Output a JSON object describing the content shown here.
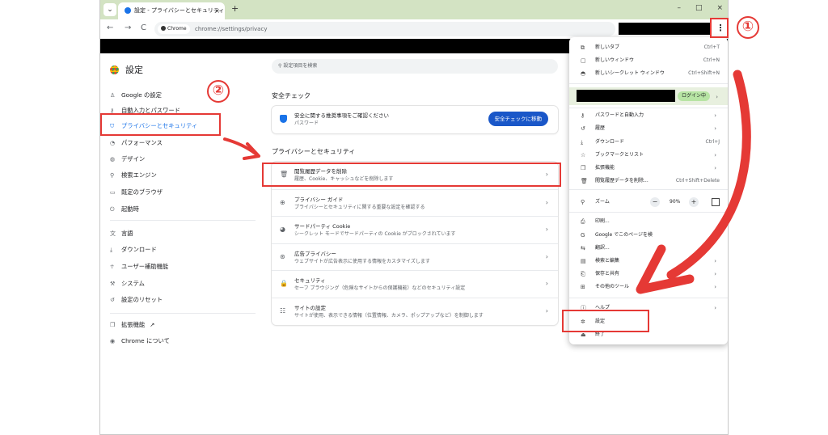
{
  "tab": {
    "title": "設定 - プライバシーとセキュリティ",
    "close": "×",
    "new": "+"
  },
  "window": {
    "minimize": "–",
    "maximize": "□",
    "close": "×",
    "dropdown": "⌄"
  },
  "toolbar": {
    "back": "←",
    "forward": "→",
    "reload": "C",
    "chip": "Chrome",
    "url": "chrome://settings/privacy",
    "menu": "⋮"
  },
  "sidebar": {
    "title": "設定",
    "items": [
      {
        "icon": "♙",
        "label": "Google の設定"
      },
      {
        "icon": "⚷",
        "label": "自動入力とパスワード"
      },
      {
        "icon": "⛉",
        "label": "プライバシーとセキュリティ"
      },
      {
        "icon": "◔",
        "label": "パフォーマンス"
      },
      {
        "icon": "◍",
        "label": "デザイン"
      },
      {
        "icon": "⚲",
        "label": "検索エンジン"
      },
      {
        "icon": "▭",
        "label": "既定のブラウザ"
      },
      {
        "icon": "⏻",
        "label": "起動時"
      },
      {
        "icon": "文",
        "label": "言語"
      },
      {
        "icon": "⤓",
        "label": "ダウンロード"
      },
      {
        "icon": "☥",
        "label": "ユーザー補助機能"
      },
      {
        "icon": "⚒",
        "label": "システム"
      },
      {
        "icon": "↺",
        "label": "設定のリセット"
      },
      {
        "icon": "❒",
        "label": "拡張機能",
        "extra": "↗"
      },
      {
        "icon": "◉",
        "label": "Chrome について"
      }
    ]
  },
  "main": {
    "search_placeholder": "設定項目を検索",
    "safety_title": "安全チェック",
    "safety": {
      "line1": "安全に関する推奨事項をご確認ください",
      "line2": "パスワード",
      "button": "安全チェックに移動"
    },
    "privacy_title": "プライバシーとセキュリティ",
    "rows": [
      {
        "icon": "🗑",
        "t1": "閲覧履歴データを削除",
        "t2": "履歴、Cookie、キャッシュなどを削除します"
      },
      {
        "icon": "⊕",
        "t1": "プライバシー ガイド",
        "t2": "プライバシーとセキュリティに関する重要な設定を確認する"
      },
      {
        "icon": "◕",
        "t1": "サードパーティ Cookie",
        "t2": "シークレット モードでサードパーティの Cookie がブロックされています"
      },
      {
        "icon": "⊛",
        "t1": "広告プライバシー",
        "t2": "ウェブサイトが広告表示に使用する情報をカスタマイズします"
      },
      {
        "icon": "🔒",
        "t1": "セキュリティ",
        "t2": "セーフ ブラウジング（危険なサイトからの保護機能）などのセキュリティ設定"
      },
      {
        "icon": "☷",
        "t1": "サイトの設定",
        "t2": "サイトが使用、表示できる情報（位置情報、カメラ、ポップアップなど）を制御します"
      }
    ],
    "chevron": "›"
  },
  "menu": {
    "top": [
      {
        "icon": "⧉",
        "label": "新しいタブ",
        "shortcut": "Ctrl+T"
      },
      {
        "icon": "▢",
        "label": "新しいウィンドウ",
        "shortcut": "Ctrl+N"
      },
      {
        "icon": "◓",
        "label": "新しいシークレット ウィンドウ",
        "shortcut": "Ctrl+Shift+N"
      }
    ],
    "login": "ログイン中",
    "middle": [
      {
        "icon": "⚷",
        "label": "パスワードと自動入力",
        "shortcut": "",
        "chev": true
      },
      {
        "icon": "↺",
        "label": "履歴",
        "shortcut": "",
        "chev": true
      },
      {
        "icon": "⤓",
        "label": "ダウンロード",
        "shortcut": "Ctrl+J",
        "chev": false
      },
      {
        "icon": "☆",
        "label": "ブックマークとリスト",
        "shortcut": "",
        "chev": true
      },
      {
        "icon": "❒",
        "label": "拡張機能",
        "shortcut": "",
        "chev": true
      },
      {
        "icon": "🗑",
        "label": "閲覧履歴データを削除...",
        "shortcut": "Ctrl+Shift+Delete",
        "chev": false
      }
    ],
    "zoom": {
      "icon": "⚲",
      "label": "ズーム",
      "minus": "−",
      "value": "90%",
      "plus": "+"
    },
    "lower": [
      {
        "icon": "⎙",
        "label": "印刷...",
        "shortcut": "",
        "chev": false
      },
      {
        "icon": "G",
        "label": "Google でこのページを検",
        "shortcut": "",
        "chev": false
      },
      {
        "icon": "⇆",
        "label": "翻訳...",
        "shortcut": "",
        "chev": false
      },
      {
        "icon": "▤",
        "label": "検索と編集",
        "shortcut": "",
        "chev": true
      },
      {
        "icon": "⎗",
        "label": "保存と共有",
        "shortcut": "",
        "chev": true
      },
      {
        "icon": "⊞",
        "label": "その他のツール",
        "shortcut": "",
        "chev": true
      }
    ],
    "help": {
      "icon": "ⓘ",
      "label": "ヘルプ"
    },
    "settings": {
      "icon": "✲",
      "label": "設定"
    },
    "quit": {
      "icon": "⏏",
      "label": "終了"
    }
  },
  "annotations": {
    "num1": "①",
    "num2": "②",
    "color": "#e53935"
  }
}
